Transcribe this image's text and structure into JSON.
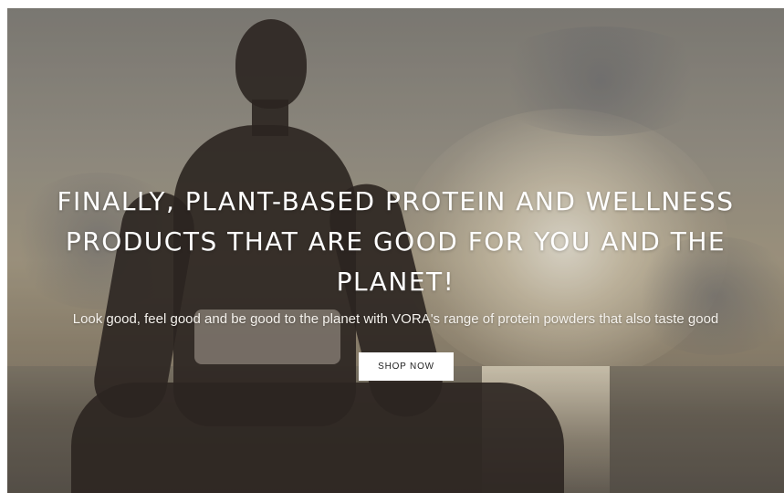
{
  "hero": {
    "headline": "FINALLY, PLANT-BASED PROTEIN AND WELLNESS PRODUCTS THAT ARE GOOD FOR YOU AND THE PLANET!",
    "subline": "Look good, feel good and be good to the planet with VORA's range of protein powders that also taste good",
    "cta_label": "SHOP NOW"
  }
}
